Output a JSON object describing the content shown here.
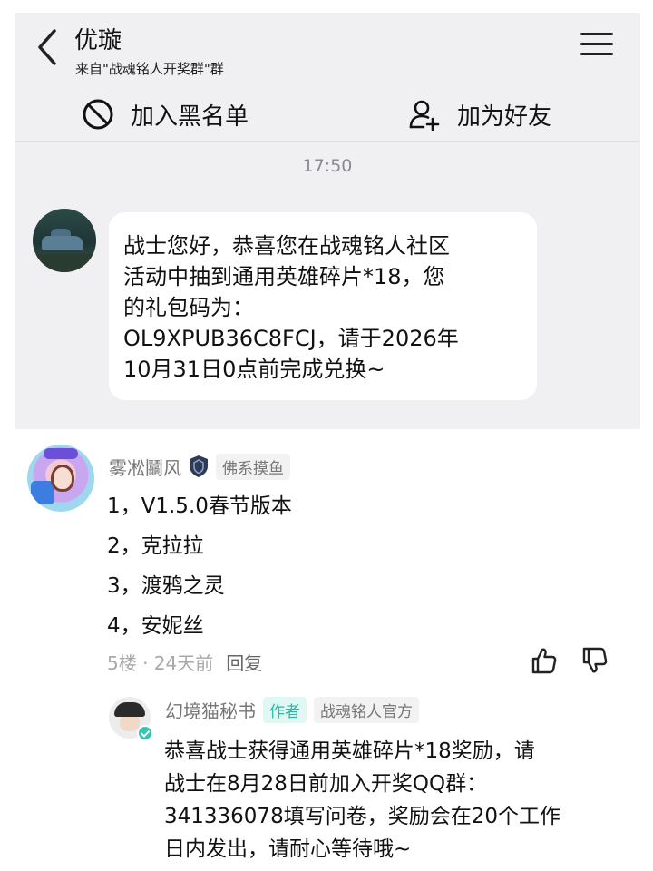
{
  "chat": {
    "title": "优璇",
    "subtitle": "来自\"战魂铭人开奖群\"群",
    "actions": {
      "block_label": "加入黑名单",
      "add_friend_label": "加为好友"
    },
    "time": "17:50",
    "message_lines": [
      "战士您好，恭喜您在战魂铭人社区",
      "活动中抽到通用英雄碎片*18，您",
      "的礼包码为：",
      "OL9XPUB36C8FCJ，请于2026年",
      "10月31日0点前完成兑换~"
    ]
  },
  "comment": {
    "username": "雾凇鬮风",
    "badge": "佛系摸鱼",
    "lines": [
      "1，V1.5.0春节版本",
      "2，克拉拉",
      "3，渡鸦之灵",
      "4，安妮丝"
    ],
    "meta": "5楼 · 24天前",
    "reply_label": "回复",
    "icons": {
      "like": "thumbs-up-icon",
      "dislike": "thumbs-down-icon"
    }
  },
  "reply": {
    "username": "幻境猫秘书",
    "author_badge": "作者",
    "org_badge": "战魂铭人官方",
    "lines": [
      "恭喜战士获得通用英雄碎片*18奖励，请",
      "战士在8月28日前加入开奖QQ群：",
      "341336078填写问卷，奖励会在20个工作",
      "日内发出，请耐心等待哦~"
    ]
  },
  "colors": {
    "chat_background": "#f0f0f2",
    "author_badge": "#2bb8a3",
    "muted_text": "#777777"
  }
}
